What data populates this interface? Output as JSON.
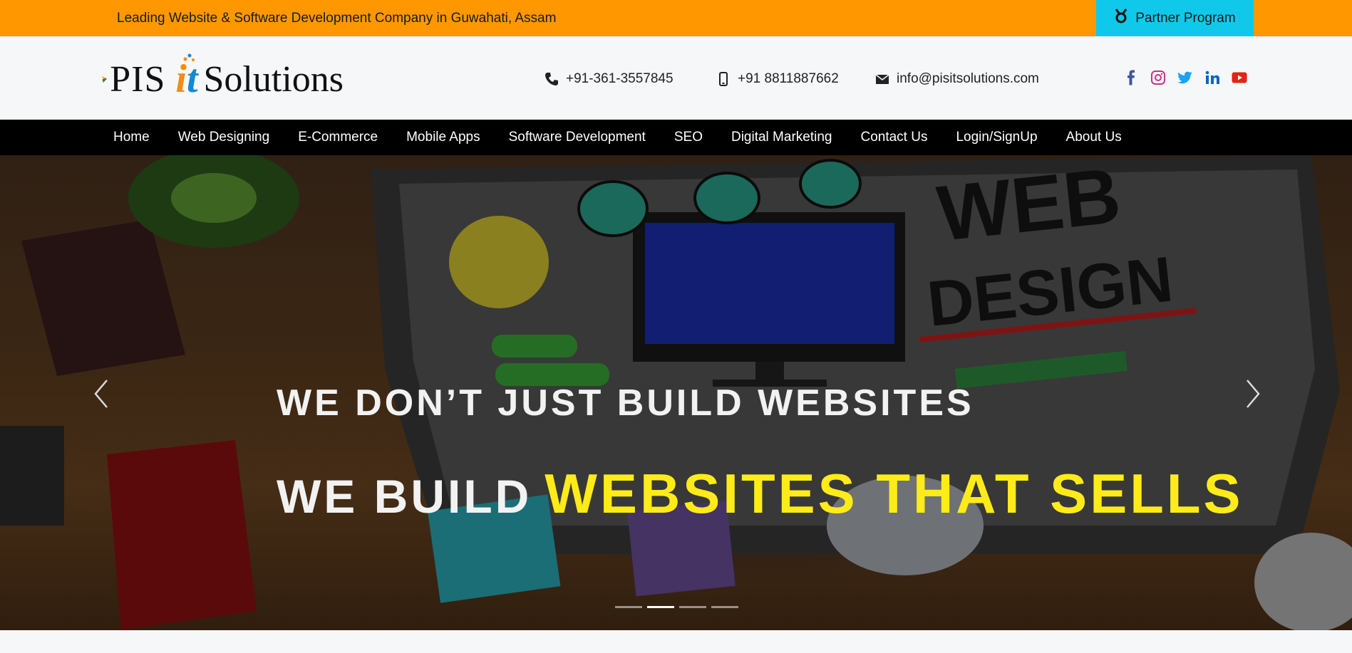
{
  "topbar": {
    "tagline": "Leading Website & Software Development Company in Guwahati, Assam",
    "partner_label": "Partner Program",
    "bg_color": "#ff9800",
    "partner_color": "#10c8ea"
  },
  "logo": {
    "text_pis": "PIS",
    "text_i": "i",
    "text_t": "t",
    "text_solutions": "Solutions"
  },
  "contact": {
    "phone": "+91-361-3557845",
    "mobile": "+91 8811887662",
    "email": "info@pisitsolutions.com"
  },
  "social": [
    "facebook-icon",
    "instagram-icon",
    "twitter-icon",
    "linkedin-icon",
    "youtube-icon"
  ],
  "nav": {
    "items": [
      "Home",
      "Web Designing",
      "E-Commerce",
      "Mobile Apps",
      "Software Development",
      "SEO",
      "Digital Marketing",
      "Contact Us",
      "Login/SignUp",
      "About Us"
    ]
  },
  "hero": {
    "line1": "WE DON’T JUST BUILD WEBSITES",
    "line2_white": "WE BUILD",
    "line2_yellow": "WEBSITES THAT SELLS",
    "slide_count": 4,
    "active_slide": 2,
    "highlight_color": "#ffeb1a"
  }
}
